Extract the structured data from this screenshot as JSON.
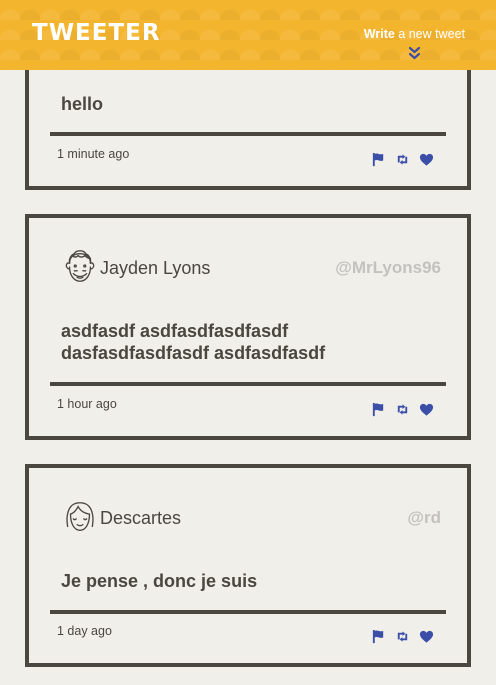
{
  "header": {
    "logo": "TWEETER",
    "write_bold": "Write",
    "write_rest": " a new tweet"
  },
  "tweets": [
    {
      "text": "hello",
      "time": "1 minute ago"
    },
    {
      "user": {
        "name": "Jayden Lyons",
        "handle": "@MrLyons96"
      },
      "text_lines": [
        "asdfasdf asdfasdfasdfasdf",
        "dasfasdfasdfasdf asdfasdfasdf"
      ],
      "time": "1 hour ago"
    },
    {
      "user": {
        "name": "Descartes",
        "handle": "@rd"
      },
      "text": "Je pense , donc je suis",
      "time": "1 day ago"
    }
  ],
  "actions": [
    "flag-icon",
    "retweet-icon",
    "heart-icon"
  ],
  "colors": {
    "header_bg": "#f4b52e",
    "accent": "#3b4fa8",
    "border": "#4a4640",
    "page_bg": "#f1efea",
    "handle": "#c4c2be"
  }
}
